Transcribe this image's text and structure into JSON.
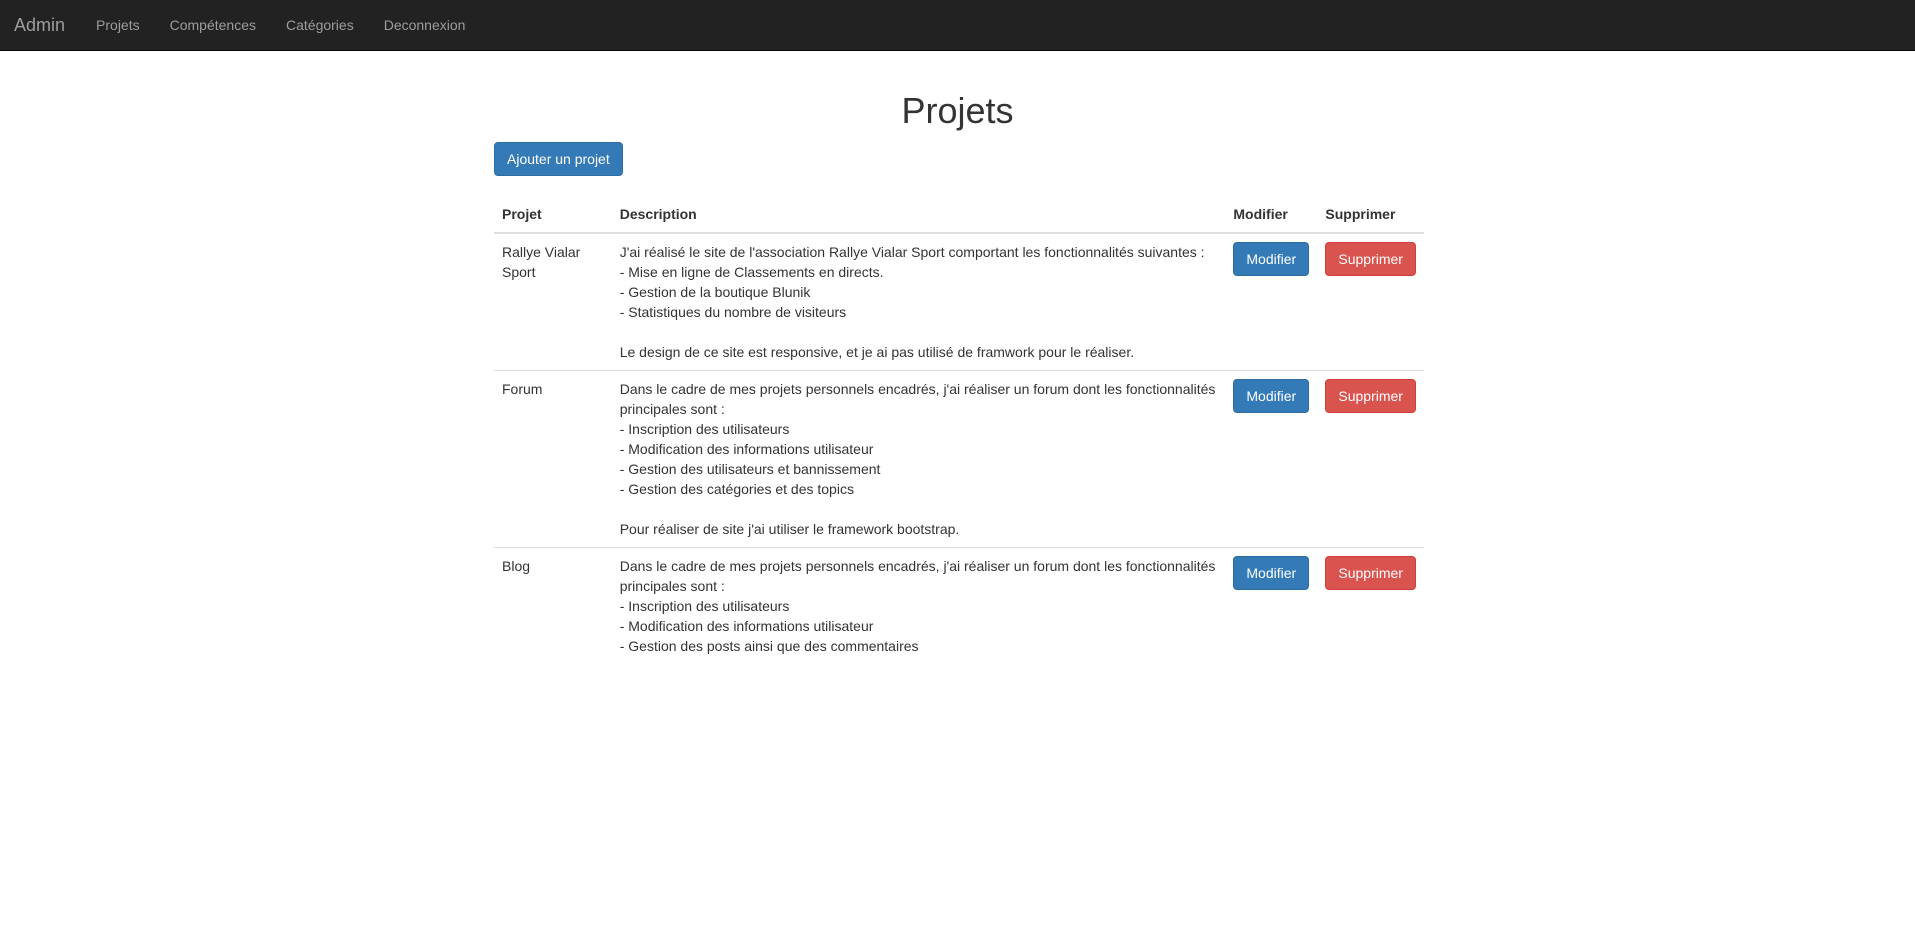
{
  "navbar": {
    "brand": "Admin",
    "items": [
      {
        "label": "Projets"
      },
      {
        "label": "Compétences"
      },
      {
        "label": "Catégories"
      },
      {
        "label": "Deconnexion"
      }
    ]
  },
  "page": {
    "title": "Projets",
    "add_button": "Ajouter un projet"
  },
  "table": {
    "headers": {
      "projet": "Projet",
      "description": "Description",
      "modifier": "Modifier",
      "supprimer": "Supprimer"
    },
    "rows": [
      {
        "name": "Rallye Vialar Sport",
        "description": "J'ai réalisé le site de l'association Rallye Vialar Sport comportant les fonctionnalités suivantes :\n- Mise en ligne de Classements en directs.\n- Gestion de la boutique Blunik\n- Statistiques du nombre de visiteurs\n\nLe design de ce site est responsive, et je ai pas utilisé de framwork pour le réaliser.",
        "modify_label": "Modifier",
        "delete_label": "Supprimer"
      },
      {
        "name": "Forum",
        "description": "Dans le cadre de mes projets personnels encadrés, j'ai réaliser un forum dont les fonctionnalités principales sont :\n- Inscription des utilisateurs\n- Modification des informations utilisateur\n- Gestion des utilisateurs et bannissement\n- Gestion des catégories et des topics\n\nPour réaliser de site j'ai utiliser le framework bootstrap.",
        "modify_label": "Modifier",
        "delete_label": "Supprimer"
      },
      {
        "name": "Blog",
        "description": "Dans le cadre de mes projets personnels encadrés, j'ai réaliser un forum dont les fonctionnalités principales sont :\n- Inscription des utilisateurs\n- Modification des informations utilisateur\n- Gestion des posts ainsi que des commentaires",
        "modify_label": "Modifier",
        "delete_label": "Supprimer"
      }
    ]
  },
  "colors": {
    "navbar_bg": "#222222",
    "nav_text": "#9d9d9d",
    "primary": "#337ab7",
    "danger": "#d9534f"
  }
}
